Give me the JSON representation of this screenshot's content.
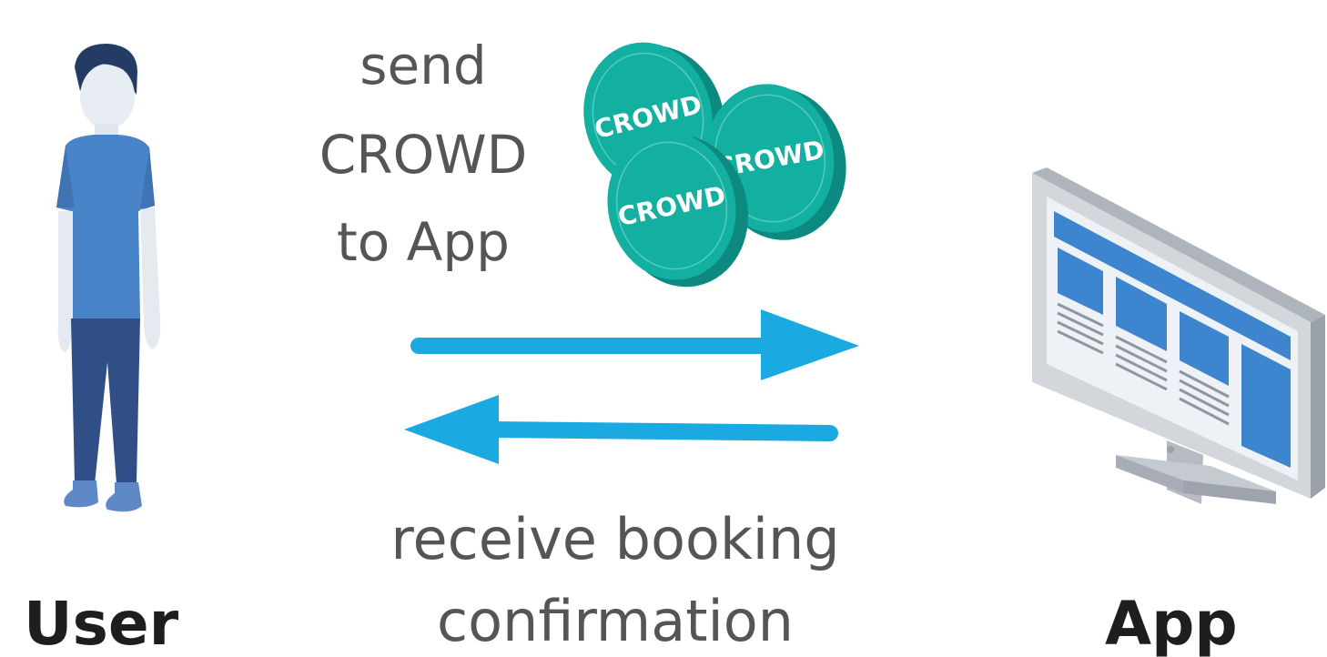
{
  "user": {
    "label": "User"
  },
  "app": {
    "label": "App"
  },
  "send_message": {
    "lines": [
      "send",
      "CROWD",
      "to App"
    ]
  },
  "coins": {
    "token_label": "CROWD",
    "colors": {
      "face": "#13b0a2",
      "rim": "#0c8a7f",
      "text": "#ffffff"
    }
  },
  "receive_message": {
    "lines": [
      "receive booking",
      "confirmation"
    ]
  },
  "colors": {
    "arrow": "#1aa9e0",
    "text": "#555555",
    "bold_text": "#1e1e1e",
    "person_shirt": "#4a84c8",
    "person_pants": "#2f4f86",
    "monitor_frame": "#c8ccd2",
    "screen_panel": "#3d86cf"
  }
}
